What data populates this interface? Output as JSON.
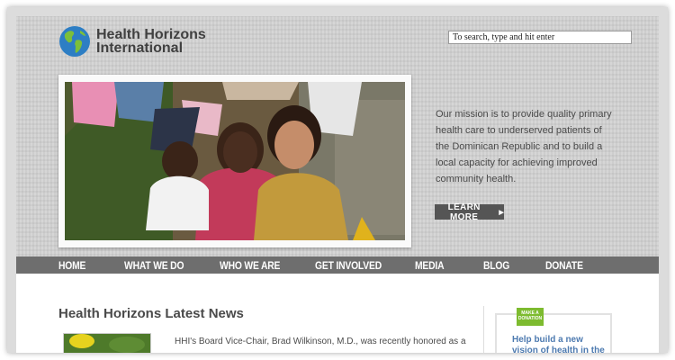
{
  "site": {
    "name_line1": "Health Horizons",
    "name_line2": "International"
  },
  "search": {
    "value": "To search, type and hit enter"
  },
  "hero": {
    "mission": "Our mission is to provide quality primary health care to underserved patients of the Dominican Republic and to build a local capacity for achieving improved community health.",
    "learn_more": "LEARN MORE"
  },
  "nav": {
    "items": [
      "HOME",
      "WHAT WE DO",
      "WHO WE ARE",
      "GET INVOLVED",
      "MEDIA",
      "BLOG",
      "DONATE"
    ]
  },
  "news": {
    "title": "Health Horizons Latest News",
    "excerpt": "HHI's Board Vice-Chair, Brad Wilkinson, M.D., was recently honored as a"
  },
  "donate": {
    "badge_line1": "MAKE A",
    "badge_line2": "DONATION",
    "text": "Help build a new vision of health in the"
  },
  "colors": {
    "nav_bg": "#6e6e6e",
    "donate_green": "#7dbb2f",
    "donate_link": "#4d7ab0",
    "body_text": "#4a4a4a"
  },
  "icons": {
    "logo": "globe-icon",
    "learn_more_arrow": "triangle-right-icon"
  }
}
